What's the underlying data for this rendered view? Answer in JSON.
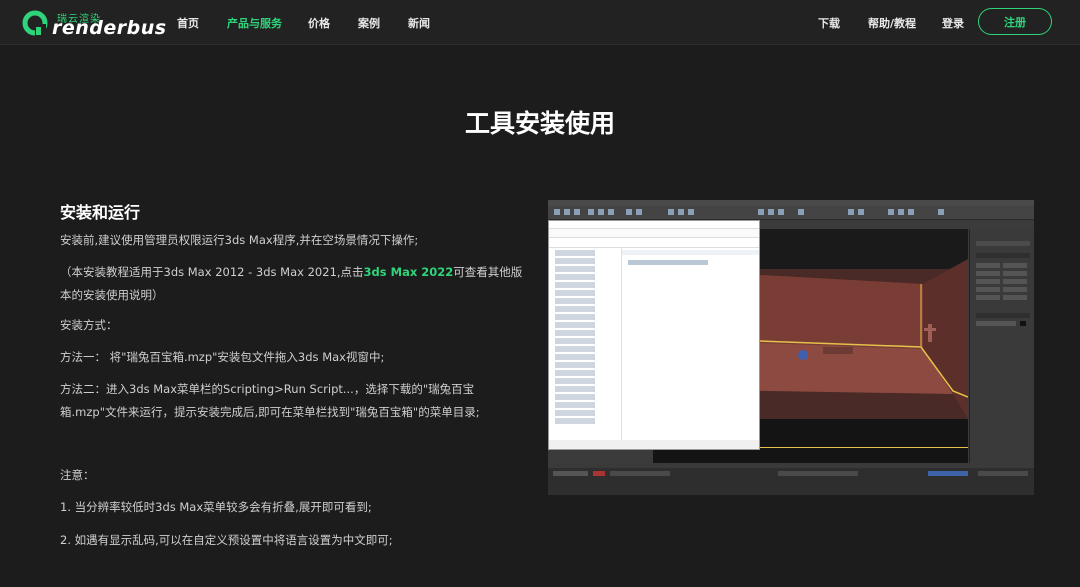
{
  "header": {
    "logo_cn": "瑞云渲染",
    "logo_en": "renderbus",
    "nav": [
      "首页",
      "产品与服务",
      "价格",
      "案例",
      "新闻"
    ],
    "nav_active_index": 1,
    "right_links": [
      "下载",
      "帮助/教程",
      "登录"
    ],
    "register_label": "注册"
  },
  "page": {
    "title": "工具安装使用"
  },
  "content": {
    "section_title": "安装和运行",
    "p1": "安装前,建议使用管理员权限运行3ds Max程序,并在空场景情况下操作;",
    "p2_pre": "（本安装教程适用于3ds Max 2012 - 3ds Max 2021,点击",
    "p2_link": "3ds Max 2022",
    "p2_post": "可查看其他版本的安装使用说明）",
    "p3": "安装方式：",
    "p4": "方法一： 将\"瑞兔百宝箱.mzp\"安装包文件拖入3ds Max视窗中;",
    "p5": "方法二：进入3ds Max菜单栏的Scripting>Run Script...，选择下载的\"瑞兔百宝箱.mzp\"文件来运行，提示安装完成后,即可在菜单栏找到\"瑞兔百宝箱\"的菜单目录;",
    "p6": "注意：",
    "p7": "1. 当分辨率较低时3ds Max菜单较多会有折叠,展开即可看到;",
    "p8": "2. 如遇有显示乱码,可以在自定义预设置中将语言设置为中文即可;"
  },
  "colors": {
    "accent": "#2fd47a",
    "background": "#1c1c1c",
    "header_bg": "#222222"
  }
}
